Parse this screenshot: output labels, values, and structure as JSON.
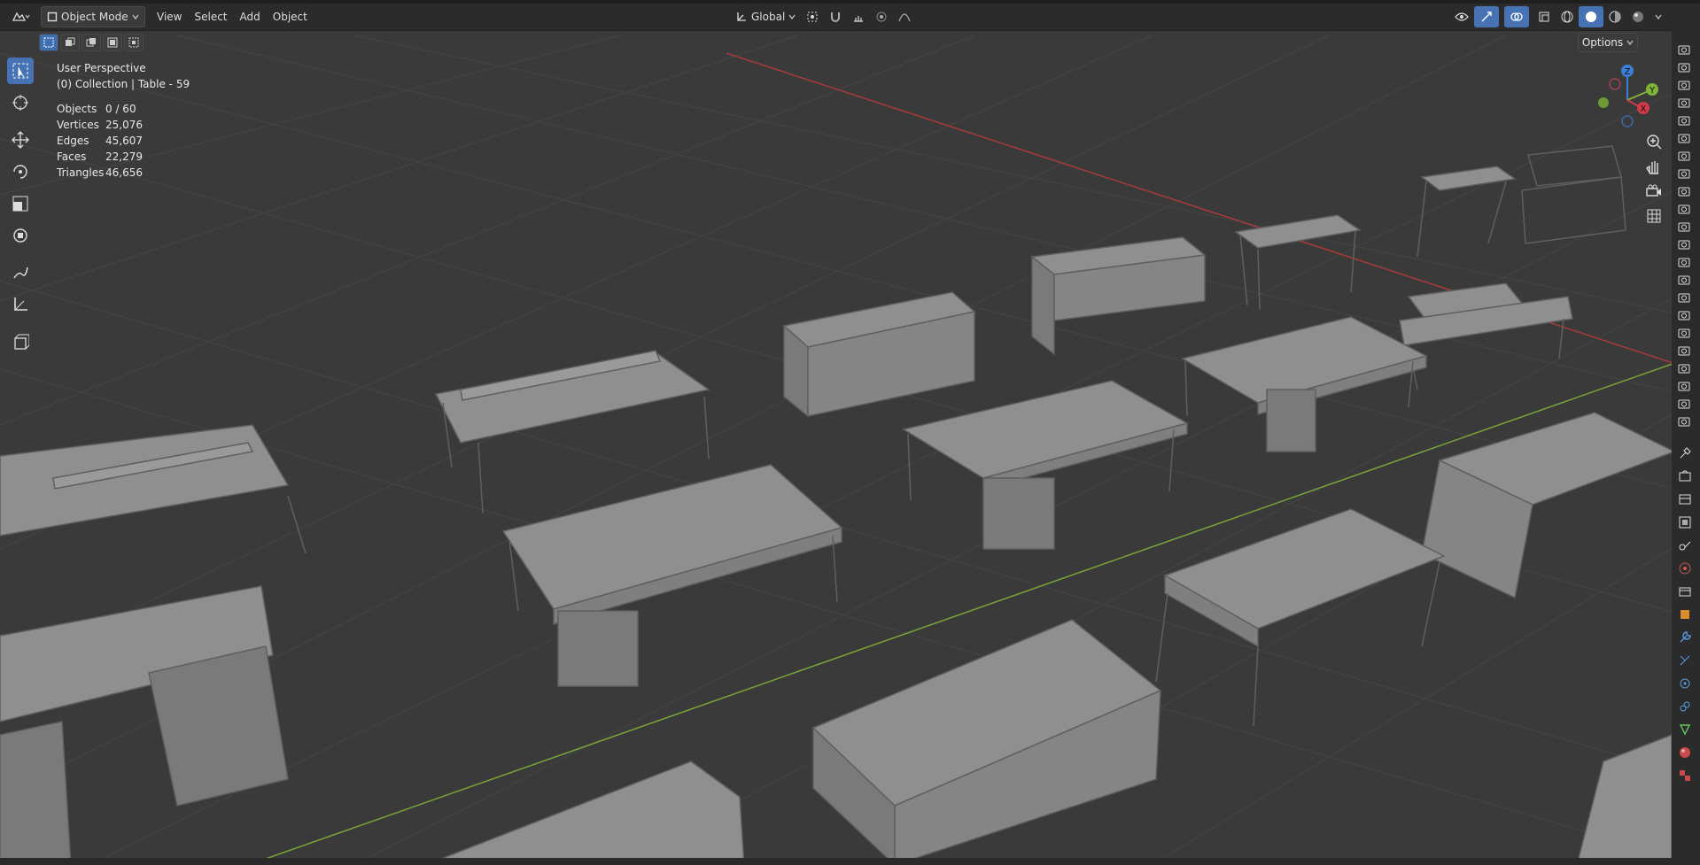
{
  "header": {
    "mode_label": "Object Mode",
    "menus": [
      "View",
      "Select",
      "Add",
      "Object"
    ],
    "transform_orientation": "Global"
  },
  "viewport": {
    "view_name": "User Perspective",
    "collection_line": "(0) Collection | Table - 59",
    "stats": [
      {
        "label": "Objects",
        "value": "0 / 60"
      },
      {
        "label": "Vertices",
        "value": "25,076"
      },
      {
        "label": "Edges",
        "value": "45,607"
      },
      {
        "label": "Faces",
        "value": "22,279"
      },
      {
        "label": "Triangles",
        "value": "46,656"
      }
    ],
    "options_label": "Options",
    "gizmo": {
      "x": "X",
      "y": "Y",
      "z": "Z"
    }
  },
  "tools": [
    {
      "name": "select-box-tool",
      "icon": "cursor-box-icon",
      "active": true
    },
    {
      "name": "cursor-tool",
      "icon": "crosshair-icon",
      "active": false
    },
    {
      "name": "move-tool",
      "icon": "move-arrows-icon",
      "active": false
    },
    {
      "name": "rotate-tool",
      "icon": "rotate-icon",
      "active": false
    },
    {
      "name": "scale-tool",
      "icon": "scale-icon",
      "active": false
    },
    {
      "name": "transform-tool",
      "icon": "transform-icon",
      "active": false
    },
    {
      "name": "annotate-tool",
      "icon": "pencil-icon",
      "active": false
    },
    {
      "name": "measure-tool",
      "icon": "ruler-icon",
      "active": false
    },
    {
      "name": "add-cube-tool",
      "icon": "cube-add-icon",
      "active": false
    }
  ],
  "colors": {
    "viewport_bg": "#3a3a3a",
    "grid_line": "#444444",
    "axis_x": "#a83a3a",
    "axis_y": "#7aa33a",
    "accent": "#4772b3",
    "mesh": "#8f8f8f"
  }
}
